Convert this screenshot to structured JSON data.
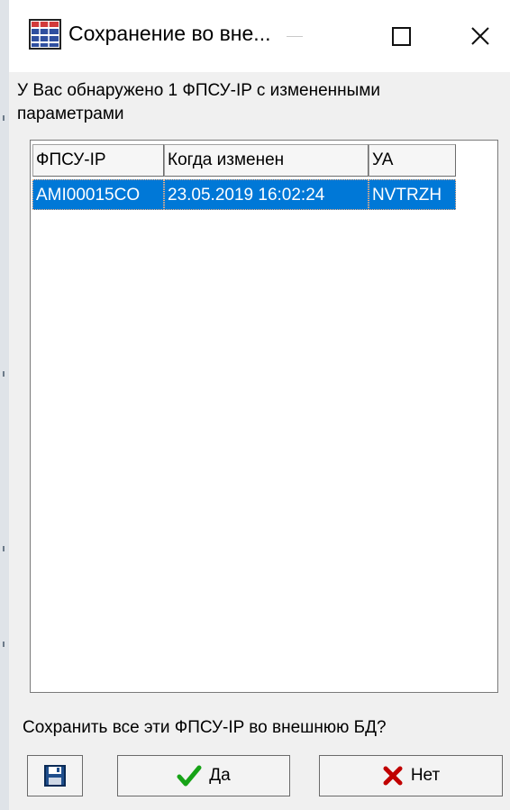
{
  "window": {
    "title": "Сохранение во вне..."
  },
  "message": "У Вас обнаружено 1 ФПСУ-IP с измененными параметрами",
  "table": {
    "columns": [
      "ФПСУ-IP",
      "Когда изменен",
      "УА"
    ],
    "rows": [
      [
        "AMI00015CO",
        "23.05.2019 16:02:24",
        "NVTRZH"
      ]
    ]
  },
  "question": "Сохранить все эти  ФПСУ-IP во внешнюю БД?",
  "buttons": {
    "yes_label": "Да",
    "no_label": "Нет"
  },
  "colors": {
    "selection": "#0078d7",
    "check": "#17a317",
    "cross": "#c00000"
  }
}
